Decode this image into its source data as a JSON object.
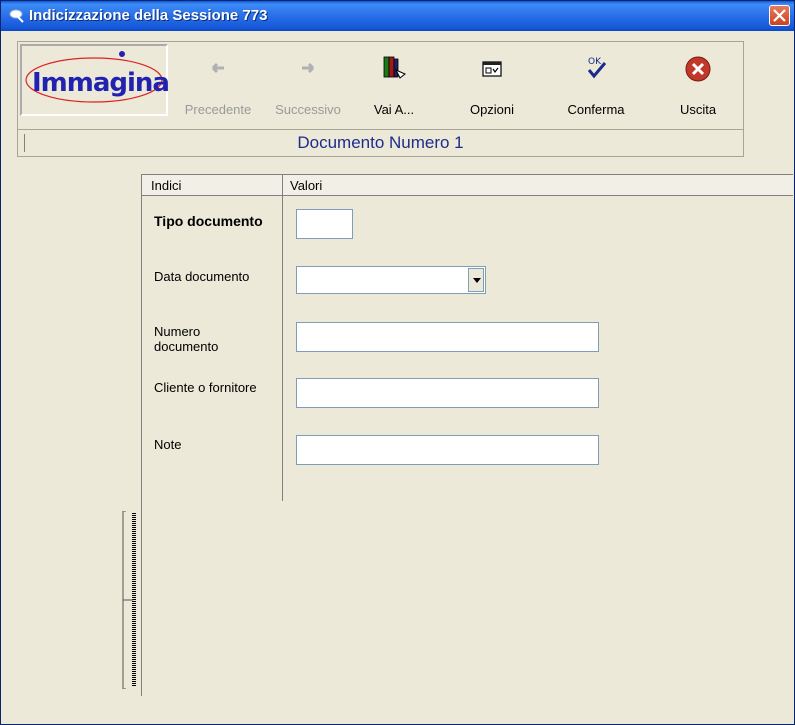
{
  "window": {
    "title": "Indicizzazione della Sessione 773"
  },
  "logo": {
    "text": "Immagina"
  },
  "toolbar": {
    "buttons": [
      {
        "label": "Precedente",
        "icon": "arrow-left-icon",
        "enabled": false
      },
      {
        "label": "Successivo",
        "icon": "arrow-right-icon",
        "enabled": false
      },
      {
        "label": "Vai A...",
        "icon": "goto-book-icon",
        "enabled": true
      },
      {
        "label": "Opzioni",
        "icon": "options-window-icon",
        "enabled": true
      },
      {
        "label": "Conferma",
        "icon": "ok-check-icon",
        "enabled": true
      },
      {
        "label": "Uscita",
        "icon": "exit-icon",
        "enabled": true
      }
    ]
  },
  "document": {
    "title": "Documento Numero 1"
  },
  "grid": {
    "columns": [
      "Indici",
      "Valori"
    ],
    "rows": [
      {
        "label": "Tipo documento",
        "value": "",
        "bold": true
      },
      {
        "label": "Data documento",
        "value": ""
      },
      {
        "label": "Numero documento",
        "value": ""
      },
      {
        "label": "Cliente o fornitore",
        "value": ""
      },
      {
        "label": "Note",
        "value": ""
      }
    ]
  },
  "colors": {
    "title_bar": "#2a6fe8",
    "doc_title": "#1c2d8c",
    "logo_text": "#2222b0",
    "exit_red": "#c0392b"
  }
}
